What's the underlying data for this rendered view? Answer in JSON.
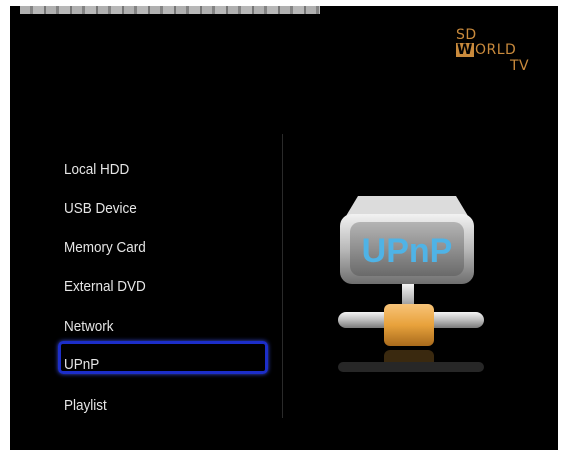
{
  "brand": {
    "line1": "SD",
    "line2_w": "W",
    "line2_rest": "ORLD",
    "line3": "TV",
    "color": "#c98a3c"
  },
  "menu": {
    "items": [
      {
        "label": "Local HDD",
        "selected": false
      },
      {
        "label": "USB Device",
        "selected": false
      },
      {
        "label": "Memory Card",
        "selected": false
      },
      {
        "label": "External DVD",
        "selected": false
      },
      {
        "label": "Network",
        "selected": false
      },
      {
        "label": "UPnP",
        "selected": true
      },
      {
        "label": "Playlist",
        "selected": false
      }
    ],
    "highlight_color": "#1c2ec9"
  },
  "preview": {
    "icon": "upnp-network-icon",
    "label": "UPnP",
    "label_color": "#4fb3e6",
    "connector_color": "#e8a23c"
  }
}
